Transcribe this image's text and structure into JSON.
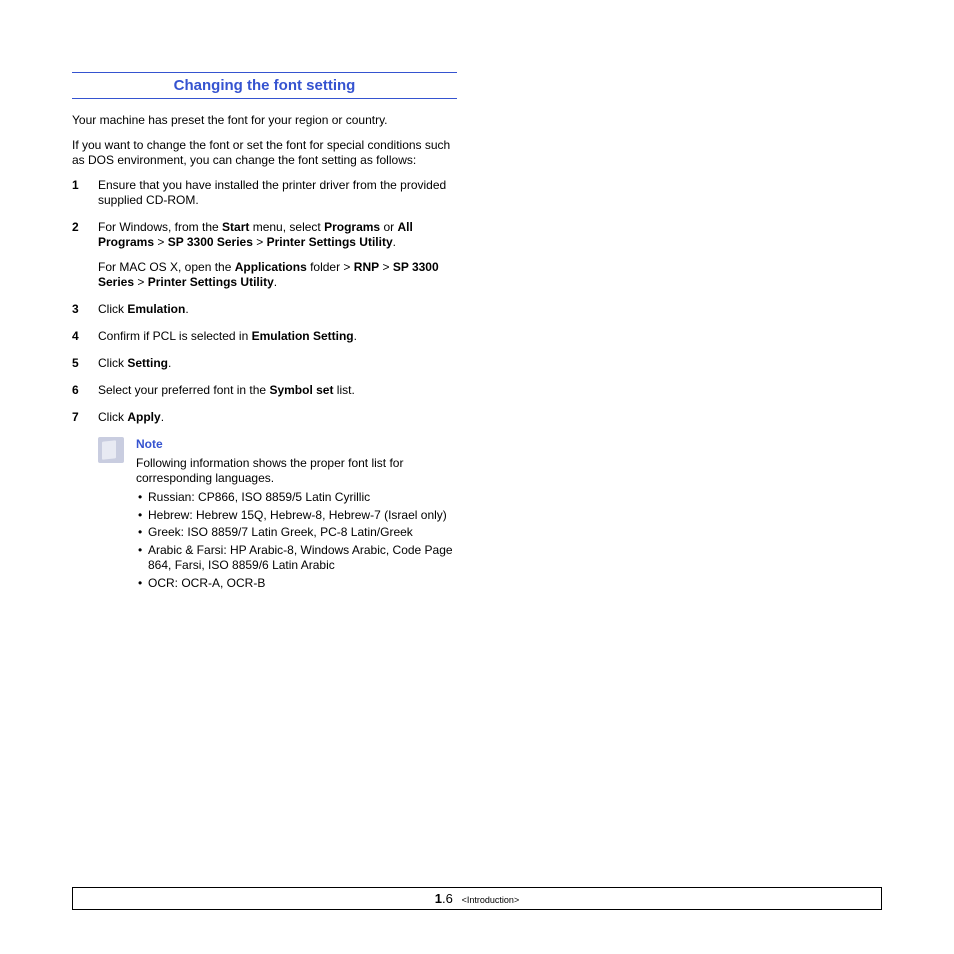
{
  "heading": "Changing the font setting",
  "intro1": "Your machine has preset the font for your region or country.",
  "intro2": "If you want to change the font or set the font for special conditions such as DOS environment, you can change the font setting as follows:",
  "steps": [
    {
      "num": "1",
      "parts": [
        {
          "t": "Ensure that you have installed the printer driver from the provided supplied CD-ROM."
        }
      ]
    },
    {
      "num": "2",
      "parts": [
        {
          "t": "For Windows, from the "
        },
        {
          "b": "Start"
        },
        {
          "t": " menu, select "
        },
        {
          "b": "Programs"
        },
        {
          "t": " or "
        },
        {
          "b": "All Programs"
        },
        {
          "t": " > "
        },
        {
          "b": "SP 3300 Series"
        },
        {
          "t": " > "
        },
        {
          "b": "Printer Settings Utility"
        },
        {
          "t": "."
        }
      ],
      "sub": [
        {
          "t": "For MAC OS X, open the "
        },
        {
          "b": "Applications"
        },
        {
          "t": " folder > "
        },
        {
          "b": "RNP"
        },
        {
          "t": " > "
        },
        {
          "b": "SP 3300 Series"
        },
        {
          "t": " > "
        },
        {
          "b": "Printer Settings Utility"
        },
        {
          "t": "."
        }
      ]
    },
    {
      "num": "3",
      "parts": [
        {
          "t": "Click "
        },
        {
          "b": "Emulation"
        },
        {
          "t": "."
        }
      ]
    },
    {
      "num": "4",
      "parts": [
        {
          "t": "Confirm if PCL is selected in "
        },
        {
          "b": "Emulation Setting"
        },
        {
          "t": "."
        }
      ]
    },
    {
      "num": "5",
      "parts": [
        {
          "t": "Click "
        },
        {
          "b": "Setting"
        },
        {
          "t": "."
        }
      ]
    },
    {
      "num": "6",
      "parts": [
        {
          "t": "Select your preferred font in the "
        },
        {
          "b": "Symbol set"
        },
        {
          "t": " list."
        }
      ]
    },
    {
      "num": "7",
      "parts": [
        {
          "t": "Click "
        },
        {
          "b": "Apply"
        },
        {
          "t": "."
        }
      ]
    }
  ],
  "note": {
    "title": "Note",
    "desc": "Following information shows the proper font list for corresponding languages.",
    "bullets": [
      "Russian: CP866, ISO 8859/5 Latin Cyrillic",
      "Hebrew: Hebrew 15Q, Hebrew-8, Hebrew-7 (Israel only)",
      "Greek: ISO 8859/7 Latin Greek, PC-8 Latin/Greek",
      "Arabic & Farsi: HP Arabic-8, Windows Arabic, Code Page 864, Farsi, ISO 8859/6 Latin Arabic",
      "OCR: OCR-A, OCR-B"
    ]
  },
  "footer": {
    "chapter": "1",
    "page": ".6",
    "section": "<Introduction>"
  }
}
